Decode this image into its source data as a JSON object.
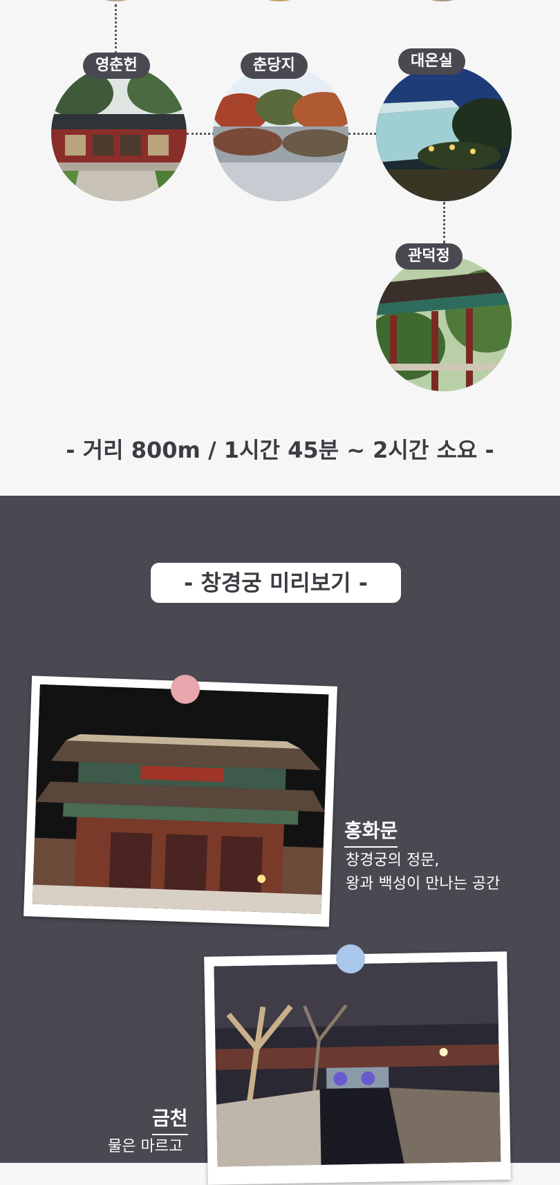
{
  "route": {
    "stops": [
      {
        "name": "영춘헌",
        "icon": "yeongchunheon-photo"
      },
      {
        "name": "춘당지",
        "icon": "chundangji-photo"
      },
      {
        "name": "대온실",
        "icon": "daeonsil-photo"
      },
      {
        "name": "관덕정",
        "icon": "gwandeokjeong-photo"
      }
    ],
    "info": "- 거리 800m / 1시간 45분 ~ 2시간 소요 -"
  },
  "preview": {
    "heading": "- 창경궁 미리보기 -",
    "places": [
      {
        "title": "홍화문",
        "desc_line1": "창경궁의 정문,",
        "desc_line2": "왕과 백성이 만나는 공간",
        "pin_color": "#e8a7ac"
      },
      {
        "title": "금천",
        "desc_line1": "물은 마르고",
        "pin_color": "#a9c7ea"
      }
    ]
  },
  "colors": {
    "dark_bg": "#4a4850",
    "light_bg": "#f6f6f6",
    "pill_bg": "#4a4850"
  }
}
